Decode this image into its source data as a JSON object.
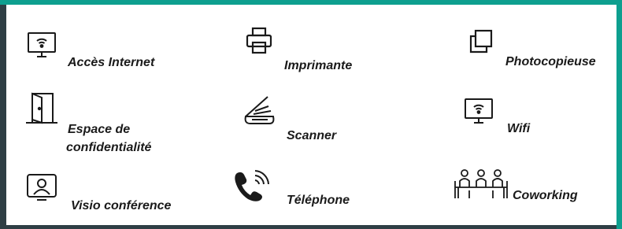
{
  "colors": {
    "frame_accent": "#0e9f8f",
    "frame_dark": "#2f3f45",
    "icon": "#1a1a1a"
  },
  "services": [
    {
      "label": "Accès Internet",
      "icon": "monitor-wifi-icon"
    },
    {
      "label": "Imprimante",
      "icon": "printer-icon"
    },
    {
      "label": "Photocopieuse",
      "icon": "copy-icon"
    },
    {
      "label": "Espace de",
      "label_line2": "confidentialité",
      "icon": "door-icon"
    },
    {
      "label": "Scanner",
      "icon": "scanner-icon"
    },
    {
      "label": "Wifi",
      "icon": "monitor-wifi-icon"
    },
    {
      "label": "Visio conférence",
      "icon": "video-call-icon"
    },
    {
      "label": "Téléphone",
      "icon": "phone-icon"
    },
    {
      "label": "Coworking",
      "icon": "coworking-icon"
    }
  ]
}
